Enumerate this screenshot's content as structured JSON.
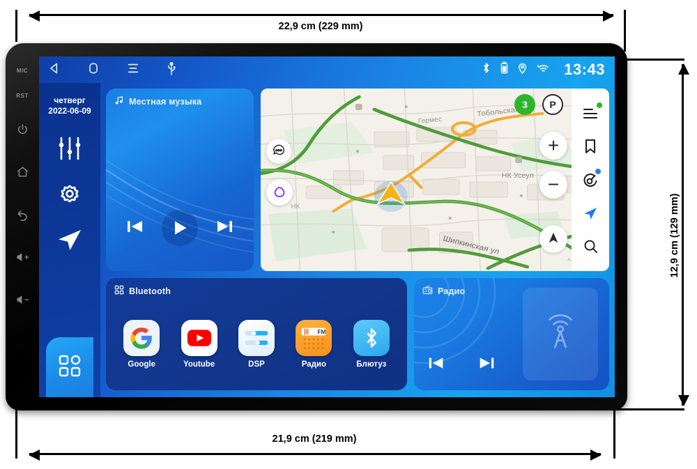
{
  "annotations": {
    "top_width": "22,9 cm (229 mm)",
    "bottom_width": "21,9 cm (219 mm)",
    "right_height": "12,9 cm (129 mm)"
  },
  "device": {
    "bezel_left": {
      "mic_label": "MIC",
      "rst_label": "RST",
      "icons": [
        "power-icon",
        "home-icon",
        "back-icon",
        "volume-up-icon",
        "volume-down-icon"
      ]
    }
  },
  "statusbar": {
    "nav_icons": [
      "back-icon",
      "home-icon",
      "recents-icon",
      "usb-icon"
    ],
    "system_icons": [
      "bluetooth-icon",
      "battery-icon",
      "location-icon",
      "wifi-icon"
    ],
    "clock": "13:43"
  },
  "rail": {
    "day_of_week": "четверг",
    "date": "2022-06-09",
    "icons": [
      "equalizer-icon",
      "settings-icon",
      "navigation-icon",
      "apps-grid-icon"
    ]
  },
  "music_card": {
    "title": "Местная музыка",
    "icon": "music-note-icon",
    "controls": [
      "previous-icon",
      "play-icon",
      "next-icon"
    ]
  },
  "map_card": {
    "street_labels": [
      "Тобольская ул",
      "Шипкинская ул",
      "НК Усеул",
      "Гермес"
    ],
    "traffic_badge": "3",
    "parking_badge": "P",
    "fab_zoom_in": "+",
    "fab_zoom_out": "−",
    "fab_compass": "north-arrow-icon",
    "left_buttons": [
      "chat-bubble-icon",
      "alice-triangle-icon"
    ],
    "poi_label": "НК",
    "toolbar_icons": [
      "menu-icon",
      "bookmark-icon",
      "discovery-icon",
      "navigate-arrow-icon",
      "search-icon"
    ],
    "accent_green": "#2bb62b",
    "accent_blue": "#1f7aff",
    "accent_purple": "#8b3ff0"
  },
  "apps_card": {
    "title": "Bluetooth",
    "icon": "apps-grid-icon",
    "apps": [
      {
        "label": "Google",
        "icon": "google-icon"
      },
      {
        "label": "Youtube",
        "icon": "youtube-icon"
      },
      {
        "label": "DSP",
        "icon": "dsp-icon"
      },
      {
        "label": "Радио",
        "icon": "radio-icon"
      },
      {
        "label": "Блютуз",
        "icon": "bluetooth-icon"
      }
    ]
  },
  "radio_card": {
    "title": "Радио",
    "icon": "radio-device-icon",
    "controls": [
      "previous-icon",
      "next-icon"
    ],
    "artwork_icon": "radio-tower-icon"
  },
  "colors": {
    "screen_blue_dark": "#0e3fa6",
    "screen_blue_light": "#17a3ef",
    "rail_blue": "#0d3898",
    "card_navy": "#123a9a",
    "bezel_black": "#0a0a0a"
  }
}
